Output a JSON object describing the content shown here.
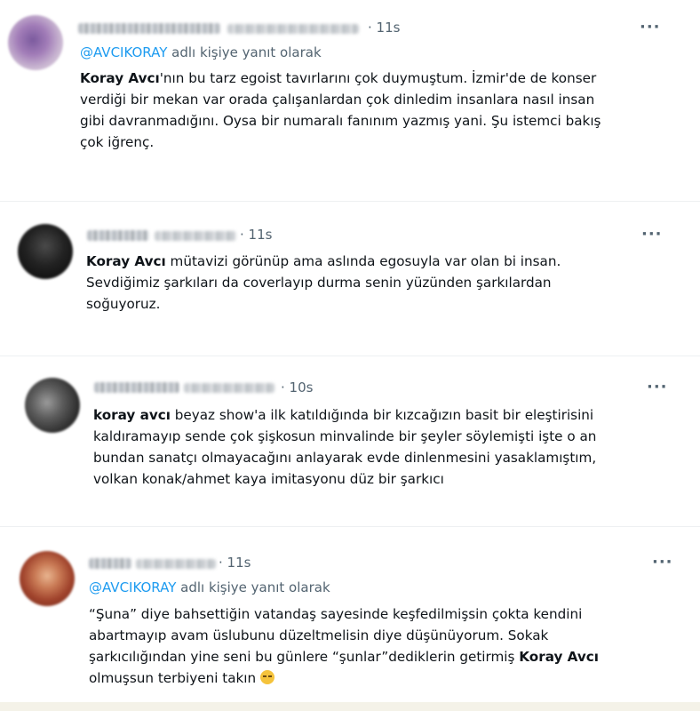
{
  "tweets": [
    {
      "time": "· 11s",
      "more_icon": "···",
      "reply_prefix": "@AVCIKORAY",
      "reply_suffix": " adlı kişiye yanıt olarak",
      "lines": [
        {
          "bold": "Koray Avcı",
          "text": "'nın bu tarz egoist tavırlarını çok duymuştum. İzmir'de de konser"
        },
        {
          "bold": "",
          "text": "verdiği bir mekan var orada çalışanlardan çok dinledim insanlara nasıl insan"
        },
        {
          "bold": "",
          "text": "gibi davranmadığını. Oysa bir numaralı fanınım yazmış yani. Şu istemci bakış"
        },
        {
          "bold": "",
          "text": "çok iğrenç."
        }
      ]
    },
    {
      "time": "· 11s",
      "more_icon": "···",
      "lines": [
        {
          "bold": "Koray Avcı",
          "text": " mütavizi görünüp ama aslında egosuyla var olan bi insan."
        },
        {
          "bold": "",
          "text": "Sevdiğimiz şarkıları da coverlayıp durma senin yüzünden şarkılardan"
        },
        {
          "bold": "",
          "text": "soğuyoruz."
        }
      ]
    },
    {
      "time": "· 10s",
      "more_icon": "···",
      "lines": [
        {
          "bold": "koray avcı",
          "text": " beyaz show'a ilk katıldığında bir kızcağızın basit bir eleştirisini"
        },
        {
          "bold": "",
          "text": "kaldıramayıp sende çok şişkosun minvalinde bir şeyler söylemişti işte o an"
        },
        {
          "bold": "",
          "text": "bundan sanatçı olmayacağını anlayarak evde dinlenmesini yasaklamıştım,"
        },
        {
          "bold": "",
          "text": "volkan konak/ahmet kaya imitasyonu düz bir şarkıcı"
        }
      ]
    },
    {
      "time": "· 11s",
      "more_icon": "···",
      "reply_prefix": "@AVCIKORAY",
      "reply_suffix": " adlı kişiye yanıt olarak",
      "lines": [
        {
          "bold": "",
          "text": "“Şuna” diye bahsettiğin vatandaş sayesinde keşfedilmişsin çokta kendini"
        },
        {
          "bold": "",
          "text": "abartmayıp avam üslubunu düzeltmelisin diye düşünüyorum. Sokak"
        },
        {
          "bold": "",
          "text": "şarkıcılığından yine seni bu günlere “şunlar”dediklerin getirmiş ",
          "bold_end": "Koray Avcı"
        },
        {
          "bold": "",
          "text": "olmuşsun terbiyeni takın "
        }
      ]
    }
  ],
  "colors": {
    "accent": "#1d9bf0",
    "muted": "#536471",
    "text": "#0f1419"
  }
}
